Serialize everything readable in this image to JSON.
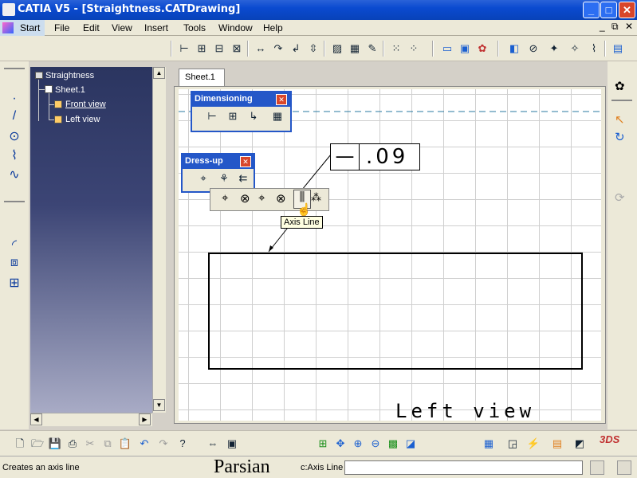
{
  "window": {
    "title": "CATIA V5 - [Straightness.CATDrawing]",
    "min": "_",
    "max": "□",
    "close": "✕"
  },
  "menu": [
    "Start",
    "File",
    "Edit",
    "View",
    "Insert",
    "Tools",
    "Window",
    "Help"
  ],
  "doc_ctrls": [
    "_",
    "⧉",
    "✕"
  ],
  "tree": {
    "root": "Straightness",
    "sheet": "Sheet.1",
    "views": [
      "Front view",
      "Left view"
    ]
  },
  "sheet_tab": "Sheet.1",
  "dimensioning_toolbar": {
    "title": "Dimensioning"
  },
  "dressup_toolbar": {
    "title": "Dress-up"
  },
  "tooltip": "Axis Line",
  "tolerance_frame": {
    "symbol": "—",
    "value": ".09"
  },
  "view_label": "Left view",
  "status": {
    "message": "Creates an axis line",
    "watermark": "Parsian",
    "command": "c:Axis Line",
    "input_value": ""
  },
  "colors": {
    "title_blue": "#0a4ad0",
    "tree_bg": "#2b3560",
    "close_red": "#d8462a"
  }
}
